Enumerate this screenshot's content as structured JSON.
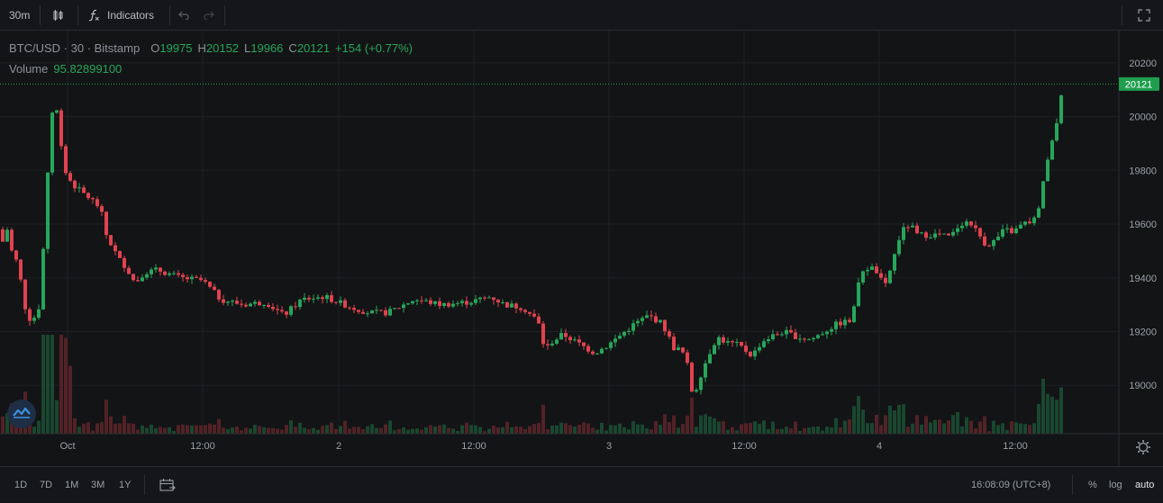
{
  "toolbar": {
    "interval": "30m",
    "indicators_label": "Indicators"
  },
  "legend": {
    "symbol": "BTC/USD · 30 · Bitstamp",
    "o_label": "O",
    "o_value": "19975",
    "h_label": "H",
    "h_value": "20152",
    "l_label": "L",
    "l_value": "19966",
    "c_label": "C",
    "c_value": "20121",
    "change": "+154 (+0.77%)",
    "volume_label": "Volume",
    "volume_value": "95.82899100"
  },
  "bottom": {
    "ranges": [
      "1D",
      "7D",
      "1M",
      "3M",
      "1Y"
    ],
    "clock": "16:08:09 (UTC+8)",
    "pct": "%",
    "log": "log",
    "auto": "auto"
  },
  "colors": {
    "up": "#26a65b",
    "down": "#e0434f",
    "background": "#131416",
    "grid": "#1e2024",
    "price_tag": "#1f9e4e"
  },
  "chart_data": {
    "type": "candlestick",
    "title": "BTC/USD · 30 · Bitstamp",
    "y_ticks": [
      20200,
      20000,
      19800,
      19600,
      19400,
      19200,
      19000
    ],
    "ylim": [
      18820,
      20320
    ],
    "x_ticks": [
      "Oct",
      "12:00",
      "2",
      "12:00",
      "3",
      "12:00",
      "4",
      "12:00"
    ],
    "last_price": 20121,
    "last_price_label": "20121",
    "grid": true
  }
}
